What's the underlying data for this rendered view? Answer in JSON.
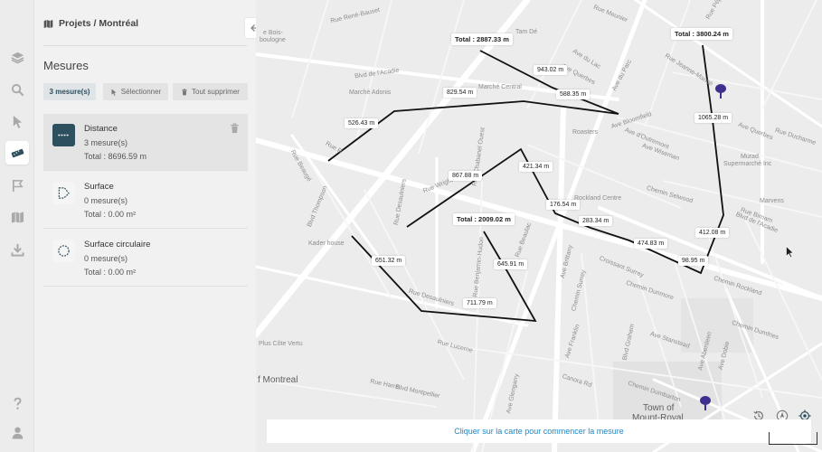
{
  "sidebar": {
    "rail_icons": [
      "layers-icon",
      "search-icon",
      "pointer-icon",
      "ruler-icon",
      "flag-icon",
      "map-icon",
      "download-icon",
      "help-icon",
      "user-icon"
    ],
    "active_icon": "ruler-icon"
  },
  "panel": {
    "breadcrumb": "Projets / Montréal",
    "title": "Mesures",
    "count_chip": "3 mesure(s)",
    "select_button": "Sélectionner",
    "delete_all_button": "Tout supprimer",
    "items": [
      {
        "name": "Distance",
        "count": "3 mesure(s)",
        "total": "Total : 8696.59 m"
      },
      {
        "name": "Surface",
        "count": "0 mesure(s)",
        "total": "Total : 0.00 m²"
      },
      {
        "name": "Surface circulaire",
        "count": "0 mesure(s)",
        "total": "Total : 0.00 m²"
      }
    ]
  },
  "map": {
    "hint": "Cliquer sur la carte pour commencer la mesure",
    "totals": [
      "Total : 2887.33 m",
      "Total : 3800.24 m",
      "Total : 2009.02 m"
    ],
    "segments": [
      "943.02 m",
      "829.54 m",
      "588.35 m",
      "526.43 m",
      "1065.28 m",
      "421.34 m",
      "867.88 m",
      "176.54 m",
      "283.34 m",
      "412.08 m",
      "474.83 m",
      "98.95 m",
      "651.32 m",
      "645.91 m",
      "711.79 m"
    ],
    "labels": {
      "rene_bauset": "Rue René-Bauset",
      "tam_de": "Tam Dé",
      "bois": "e Bois-",
      "boulogne": "boulogne",
      "meunier": "Rue Meunier",
      "pepe": "Rue Pépé",
      "ave_lac": "Ave du Lac",
      "ave_acadie": "Blvd de l'Acadie",
      "marche_adonis": "Marché Adonis",
      "marche_central": "Marché Central",
      "querbes": "Ave Querbes",
      "jeanne_mance": "Rue Jeanne-Mance",
      "ave_parc": "Ave du Parc",
      "roasters": "Roasters",
      "ave_bloomfield": "Ave Bloomfield",
      "outremont": "Ave d'Outremont",
      "wiseman": "Ave Wiseman",
      "querbes2": "Ave Querbes",
      "ducharme": "Rue Ducharme",
      "murad": "Murad",
      "supermarche": "Supermarché Inc",
      "chabanel": "Rue Chabanel Ouest",
      "rue_wright": "Rue Wright",
      "beauge": "Rue Beaugé",
      "thompson": "Blvd Thompson",
      "ave_r": "Rue R",
      "kader": "Kader house",
      "desjardins": "Rue Desaulniers",
      "rockland_centre": "Rockland Centre",
      "chemin_selwood": "Chemin Selwood",
      "marvens": "Marvens",
      "birnam": "Rue Birnam",
      "ave_acadie2": "Blvd de l'Acadie",
      "rockland_rd": "Chemin Rockland",
      "croissant_surrey": "Croissant Surrey",
      "chemin_dunmore": "Chemin Dunmore",
      "dumfries": "Chemin Dumfries",
      "rue_benjamin": "Rue Benjamin-Hudon",
      "rue_desaulniers2": "Rue Desaulniers",
      "rue_beaulac": "Rue Beaulac",
      "ave_brittany": "Ave Brittany",
      "chemin_surrey": "Chemin Surrey",
      "graham": "Blvd Graham",
      "ave_stan": "Ave Stanstead",
      "canora": "Canora Rd",
      "dumbarton": "Chemin Dumbarton",
      "ave_franklin": "Ave Franklin",
      "plus_cote": "Plus Côte Vertu",
      "rue_harris": "Rue Harris",
      "rue_montpellier": "Blvd Montpellier",
      "rue_saint": "Rue Lucerne",
      "ave_glengarry": "Ave Glengarry",
      "ave_aberdeen": "Ave Aberdeen",
      "dobie": "Ave Dobie"
    },
    "cities": {
      "montreal": "f Montreal",
      "town1": "Town of",
      "town2": "Mount-Royal"
    },
    "colors": {
      "route": "#111111",
      "marker": "#3f2f8f",
      "hint": "#1e86c4"
    },
    "control_icons": [
      "history-icon",
      "compass-icon",
      "locate-icon"
    ]
  }
}
